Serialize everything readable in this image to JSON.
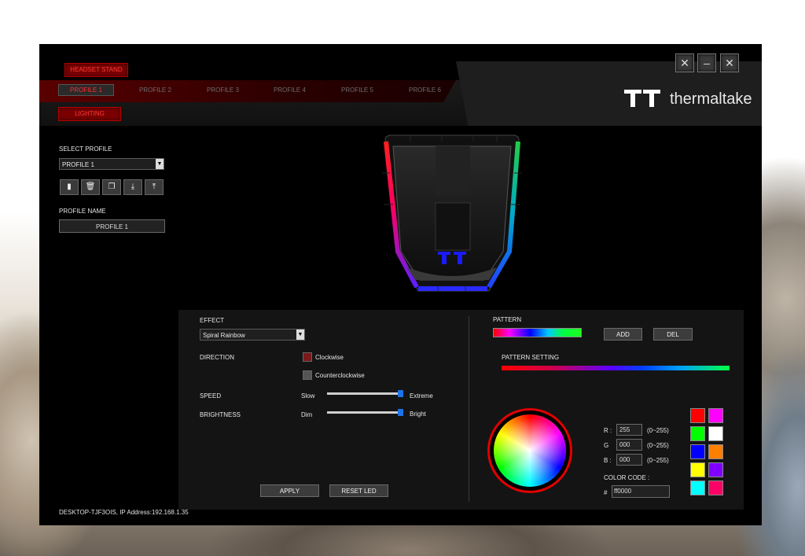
{
  "window": {
    "headset_stand_label": "HEADSET STAND",
    "lighting_label": "LIGHTING",
    "brand_name": "thermaltake",
    "brand_logo": "TT",
    "tools_icon": "wrench-screwdriver-icon",
    "minimize_icon": "minus-icon",
    "close_icon": "close-icon"
  },
  "profiles": {
    "tabs": [
      "PROFILE 1",
      "PROFILE 2",
      "PROFILE 3",
      "PROFILE 4",
      "PROFILE 5",
      "PROFILE 6"
    ],
    "active": 0
  },
  "sidebar": {
    "select_profile_label": "SELECT PROFILE",
    "selected_profile": "PROFILE 1",
    "profile_name_label": "PROFILE NAME",
    "profile_name_value": "PROFILE 1",
    "actions": [
      "new-file-icon",
      "trash-icon",
      "copy-icon",
      "import-icon",
      "export-icon"
    ]
  },
  "effect": {
    "effect_label": "EFFECT",
    "effect_value": "Spiral Rainbow",
    "direction_label": "DIRECTION",
    "clockwise_label": "Clockwise",
    "counterclockwise_label": "Counterclockwise",
    "clockwise_checked": true,
    "speed_label": "SPEED",
    "speed_min": "Slow",
    "speed_max": "Extreme",
    "speed_value": 1.0,
    "brightness_label": "BRIGHTNESS",
    "brightness_min": "Dim",
    "brightness_max": "Bright",
    "brightness_value": 1.0,
    "apply_label": "APPLY",
    "reset_label": "RESET LED"
  },
  "pattern": {
    "pattern_label": "PATTERN",
    "add_label": "ADD",
    "del_label": "DEL",
    "setting_label": "PATTERN SETTING"
  },
  "color": {
    "r_label": "R :",
    "g_label": "G",
    "b_label": "B :",
    "r_value": "255",
    "g_value": "000",
    "b_value": "000",
    "range_label": "(0~255)",
    "code_label": "COLOR CODE :",
    "hash": "#",
    "code_value": "ff0000",
    "swatches": [
      "#ff0000",
      "#ff00ff",
      "#00ff00",
      "#ffffff",
      "#0000ff",
      "#ff7f00",
      "#ffff00",
      "#7f00ff",
      "#00ffff",
      "#ff0066"
    ]
  },
  "footer": {
    "machine": "DESKTOP-TJF3OIS, IP Address:192.168.1.35"
  }
}
